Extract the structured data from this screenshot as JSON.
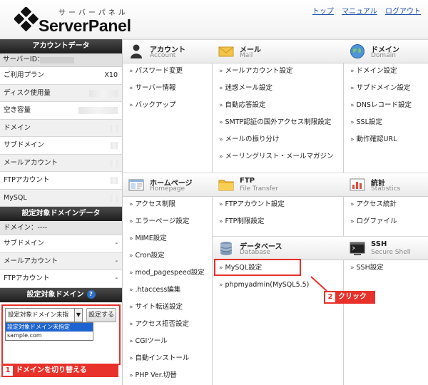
{
  "header": {
    "logo_sub": "サーバーパネル",
    "logo_main": "ServerPanel",
    "links": [
      "トップ",
      "マニュアル",
      "ログアウト"
    ]
  },
  "sidebar": {
    "account_title": "アカウントデータ",
    "server_id_label": "サーバーID：",
    "rows": [
      {
        "label": "ご利用プラン",
        "value": "X10"
      },
      {
        "label": "ディスク使用量",
        "value": ""
      },
      {
        "label": "空き容量",
        "value": ""
      },
      {
        "label": "ドメイン",
        "value": ""
      },
      {
        "label": "サブドメイン",
        "value": ""
      },
      {
        "label": "メールアカウント",
        "value": ""
      },
      {
        "label": "FTPアカウント",
        "value": ""
      },
      {
        "label": "MySQL",
        "value": ""
      }
    ],
    "domain_data_title": "設定対象ドメインデータ",
    "domain_label": "ドメイン：----",
    "domain_rows": [
      {
        "label": "サブドメイン",
        "value": "-"
      },
      {
        "label": "メールアカウント",
        "value": "-"
      },
      {
        "label": "FTPアカウント",
        "value": "-"
      }
    ],
    "target_title": "設定対象ドメイン",
    "help": "?",
    "select_value": "設定対象ドメイン未指定",
    "set_button": "設定する",
    "dropdown_options": [
      "設定対象ドメイン未指定",
      "sample.com"
    ]
  },
  "callouts": {
    "c1_num": "1",
    "c1_text": "ドメインを切り替える",
    "c2_num": "2",
    "c2_text": "クリック"
  },
  "sections": {
    "account": {
      "title": "アカウント",
      "sub": "Account",
      "items": [
        "パスワード変更",
        "サーバー情報",
        "バックアップ"
      ]
    },
    "mail": {
      "title": "メール",
      "sub": "Mail",
      "items": [
        "メールアカウント設定",
        "迷惑メール設定",
        "自動応答設定",
        "SMTP認証の国外アクセス制限設定",
        "メールの振り分け",
        "メーリングリスト・メールマガジン"
      ]
    },
    "domain": {
      "title": "ドメイン",
      "sub": "Domain",
      "items": [
        "ドメイン設定",
        "サブドメイン設定",
        "DNSレコード設定",
        "SSL設定",
        "動作確認URL"
      ]
    },
    "homepage": {
      "title": "ホームページ",
      "sub": "Homepage",
      "items": [
        "アクセス制限",
        "エラーページ設定",
        "MIME設定",
        "Cron設定",
        "mod_pagespeed設定",
        ".htaccess編集",
        "サイト転送設定",
        "アクセス拒否設定",
        "CGIツール",
        "自動インストール",
        "PHP Ver.切替"
      ]
    },
    "ftp": {
      "title": "FTP",
      "sub": "File Transfer",
      "items": [
        "FTPアカウント設定",
        "FTP制限設定"
      ]
    },
    "stats": {
      "title": "統計",
      "sub": "Statistics",
      "items": [
        "アクセス統計",
        "ログファイル"
      ]
    },
    "database": {
      "title": "データベース",
      "sub": "Database",
      "items": [
        "MySQL設定",
        "phpmyadmin(MySQL5.5)"
      ]
    },
    "ssh": {
      "title": "SSH",
      "sub": "Secure Shell",
      "items": [
        "SSH設定"
      ]
    }
  },
  "colors": {
    "highlight": "#e8312a",
    "header_dark": "#1d1d1d",
    "link": "#1a4ea8"
  }
}
